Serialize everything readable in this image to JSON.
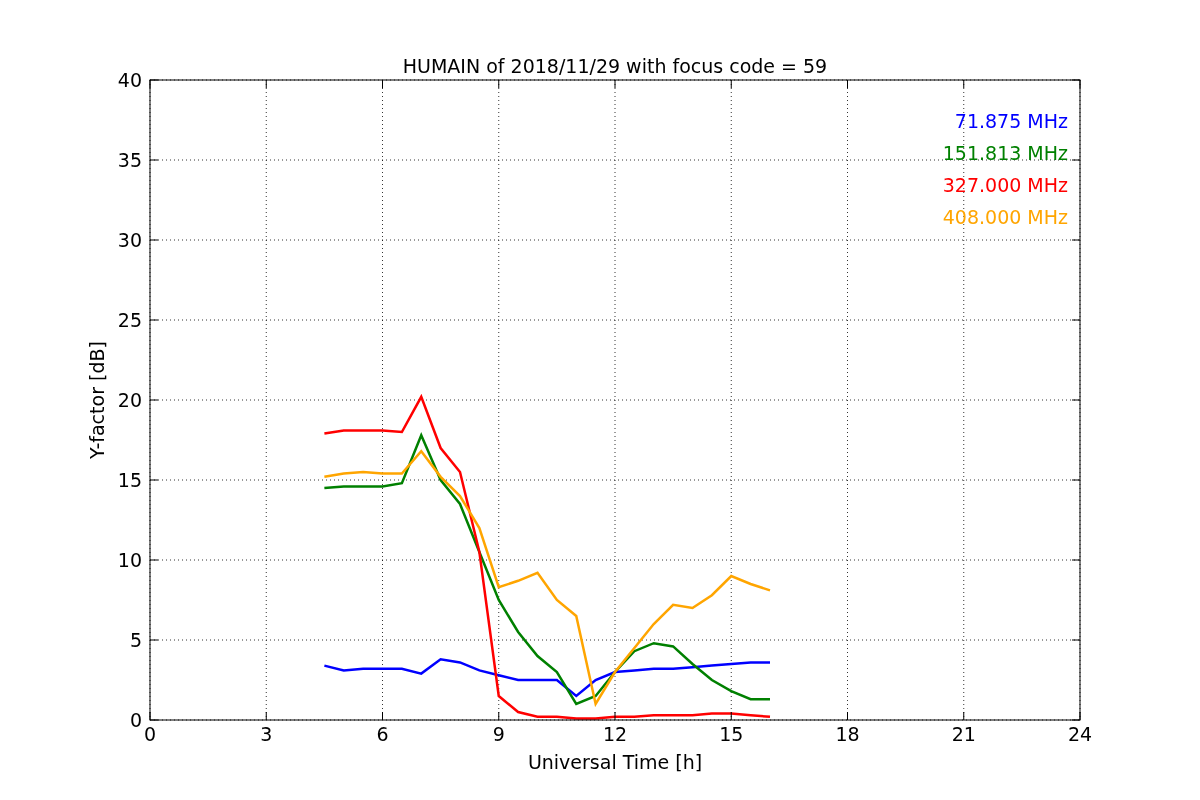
{
  "figure": {
    "chart_data": {
      "type": "line",
      "title": "HUMAIN of 2018/11/29 with focus code = 59",
      "xlabel": "Universal Time [h]",
      "ylabel": "Y-factor [dB]",
      "x": [
        4.5,
        5,
        5.5,
        6,
        6.5,
        7,
        7.5,
        8,
        8.5,
        9,
        9.5,
        10,
        10.5,
        11,
        11.5,
        12,
        12.5,
        13,
        13.5,
        14,
        14.5,
        15,
        15.5,
        16
      ],
      "series": [
        {
          "name": "71.875 MHz",
          "color": "#0000ff",
          "values": [
            3.4,
            3.1,
            3.2,
            3.2,
            3.2,
            2.9,
            3.8,
            3.6,
            3.1,
            2.8,
            2.5,
            2.5,
            2.5,
            1.5,
            2.5,
            3.0,
            3.1,
            3.2,
            3.2,
            3.3,
            3.4,
            3.5,
            3.6,
            3.6
          ]
        },
        {
          "name": "151.813 MHz",
          "color": "#008000",
          "values": [
            14.5,
            14.6,
            14.6,
            14.6,
            14.8,
            17.8,
            15.0,
            13.5,
            10.5,
            7.5,
            5.5,
            4.0,
            3.0,
            1.0,
            1.5,
            3.0,
            4.3,
            4.8,
            4.6,
            3.5,
            2.5,
            1.8,
            1.3,
            1.3
          ]
        },
        {
          "name": "327.000 MHz",
          "color": "#ff0000",
          "values": [
            17.9,
            18.1,
            18.1,
            18.1,
            18.0,
            20.2,
            17.0,
            15.5,
            10.5,
            1.5,
            0.5,
            0.2,
            0.2,
            0.1,
            0.1,
            0.2,
            0.2,
            0.3,
            0.3,
            0.3,
            0.4,
            0.4,
            0.3,
            0.2
          ]
        },
        {
          "name": "408.000 MHz",
          "color": "#ffa500",
          "values": [
            15.2,
            15.4,
            15.5,
            15.4,
            15.4,
            16.8,
            15.2,
            14.0,
            12.0,
            8.3,
            8.7,
            9.2,
            7.5,
            6.5,
            1.0,
            3.0,
            4.5,
            6.0,
            7.2,
            7.0,
            7.8,
            9.0,
            8.5,
            8.1
          ]
        }
      ],
      "xlim": [
        0,
        24
      ],
      "ylim": [
        0,
        40
      ],
      "xticks": [
        0,
        3,
        6,
        9,
        12,
        15,
        18,
        21,
        24
      ],
      "yticks": [
        0,
        5,
        10,
        15,
        20,
        25,
        30,
        35,
        40
      ],
      "grid": true
    }
  }
}
